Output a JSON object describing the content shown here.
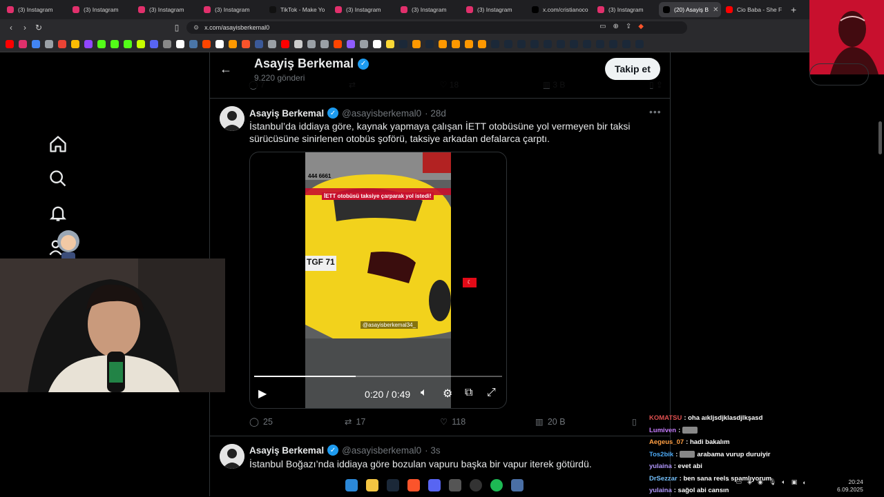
{
  "browser": {
    "tabs": [
      {
        "label": "(3) Instagram",
        "color": "#e1306c"
      },
      {
        "label": "(3) Instagram",
        "color": "#e1306c"
      },
      {
        "label": "(3) Instagram",
        "color": "#e1306c"
      },
      {
        "label": "(3) Instagram",
        "color": "#e1306c"
      },
      {
        "label": "TikTok - Make Yo",
        "color": "#111111"
      },
      {
        "label": "(3) Instagram",
        "color": "#e1306c"
      },
      {
        "label": "(3) Instagram",
        "color": "#e1306c"
      },
      {
        "label": "(3) Instagram",
        "color": "#e1306c"
      },
      {
        "label": "x.com/cristianoco",
        "color": "#000000"
      },
      {
        "label": "(3) Instagram",
        "color": "#e1306c"
      },
      {
        "label": "(20) Asayiş B",
        "color": "#000000",
        "active": true
      },
      {
        "label": "Cio Baba - She F",
        "color": "#ff0000"
      }
    ],
    "url": "x.com/asayisberkemal0"
  },
  "profile": {
    "name": "Asayiş Berkemal",
    "post_count": "9.220 gönderi",
    "follow_label": "Takip et"
  },
  "prev_tweet_actions": {
    "replies": "7",
    "reposts": "",
    "likes": "18",
    "views": "3 B"
  },
  "tweets": [
    {
      "name": "Asayiş Berkemal",
      "handle": "@asayisberkemal0",
      "time": "· 28d",
      "text": "İstanbul’da iddiaya göre, kaynak yapmaya çalışan İETT otobüsüne yol vermeyen bir taksi sürücüsüne sinirlenen otobüs şoförü, taksiye arkadan defalarca çarptı.",
      "video": {
        "caption": "İETT otobüsü taksiye çarparak yol istedi!",
        "phone": "444 6661",
        "plate": "TGF 71",
        "watermark": "@asayisberkemal34_",
        "time_label": "0:20 / 0:49",
        "progress": 0.41
      },
      "replies": "25",
      "reposts": "17",
      "likes": "118",
      "views": "20 B"
    },
    {
      "name": "Asayiş Berkemal",
      "handle": "@asayisberkemal0",
      "time": "· 3s",
      "text": "İstanbul Boğazı’nda iddiaya göre bozulan vapuru başka bir vapur iterek götürdü."
    }
  ],
  "chat": [
    {
      "user": "KOMATSU",
      "color": "#e05050",
      "msg": ": oha aıkljsdjklasdjlkşasd",
      "emote": false
    },
    {
      "user": "Lumiven",
      "color": "#c77dff",
      "msg": ":",
      "emote": true
    },
    {
      "user": "Aegeus_07",
      "color": "#ff9f43",
      "msg": ": hadi bakalım",
      "emote": false
    },
    {
      "user": "Tos2bik",
      "color": "#4dabf7",
      "msg": ": arabama vurup duruiyir",
      "emote": true
    },
    {
      "user": "yulaina",
      "color": "#b197fc",
      "msg": ": evet abi",
      "emote": false
    },
    {
      "user": "DrSezzar",
      "color": "#74c0fc",
      "msg": ": ben sana reels spamlıyorum",
      "emote": false
    },
    {
      "user": "yulaina",
      "color": "#b197fc",
      "msg": ": sağol abi cansın",
      "emote": false
    }
  ],
  "clock": {
    "time": "20:24",
    "date": "6.09.2025"
  },
  "icons": [
    "home-icon",
    "search-icon",
    "bell-icon",
    "people-icon",
    "play-icon",
    "volume-icon",
    "settings-icon",
    "pip-icon",
    "fullscreen-icon",
    "reply-icon",
    "repost-icon",
    "like-icon",
    "views-icon",
    "bookmark-icon"
  ],
  "colors": {
    "accent": "#1d9bf0",
    "bg": "#000000",
    "muted": "#71767b",
    "border": "#2f3336",
    "taxi": "#f2d21c"
  }
}
